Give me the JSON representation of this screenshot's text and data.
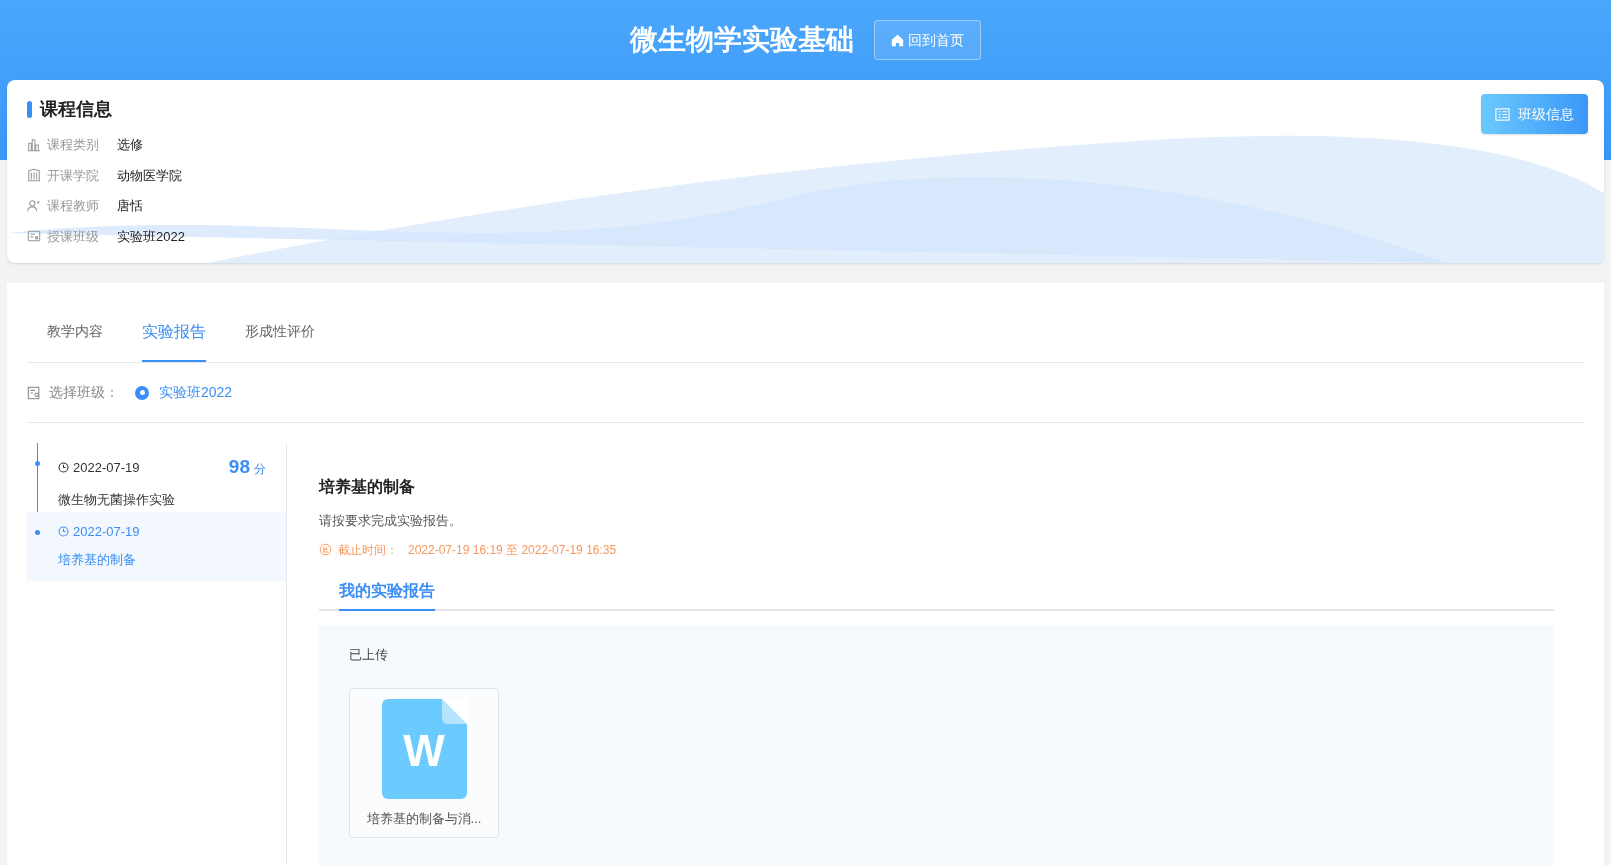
{
  "header": {
    "title": "微生物学实验基础",
    "home_button": "回到首页"
  },
  "course_info": {
    "title": "课程信息",
    "class_info_button": "班级信息",
    "fields": [
      {
        "kind": "category",
        "label": "课程类别",
        "value": "选修"
      },
      {
        "kind": "college",
        "label": "开课学院",
        "value": "动物医学院"
      },
      {
        "kind": "teacher",
        "label": "课程教师",
        "value": "唐恬"
      },
      {
        "kind": "class",
        "label": "授课班级",
        "value": "实验班2022"
      }
    ]
  },
  "tabs": [
    {
      "label": "教学内容",
      "selected": false
    },
    {
      "label": "实验报告",
      "selected": true
    },
    {
      "label": "形成性评价",
      "selected": false
    }
  ],
  "class_select": {
    "label": "选择班级：",
    "options": [
      {
        "label": "实验班2022",
        "selected": true
      }
    ]
  },
  "timeline": [
    {
      "date": "2022-07-19",
      "title": "微生物无菌操作实验",
      "score": "98",
      "score_unit": "分",
      "selected": false
    },
    {
      "date": "2022-07-19",
      "title": "培养基的制备",
      "selected": true
    }
  ],
  "detail": {
    "title": "培养基的制备",
    "description": "请按要求完成实验报告。",
    "deadline_label": "截止时间：",
    "deadline": "2022-07-19 16:19 至 2022-07-19 16:35",
    "sub_tabs": [
      {
        "label": "我的实验报告",
        "selected": true
      }
    ],
    "status": "已上传",
    "files": [
      {
        "icon_letter": "W",
        "name": "培养基的制备与消..."
      }
    ]
  }
}
